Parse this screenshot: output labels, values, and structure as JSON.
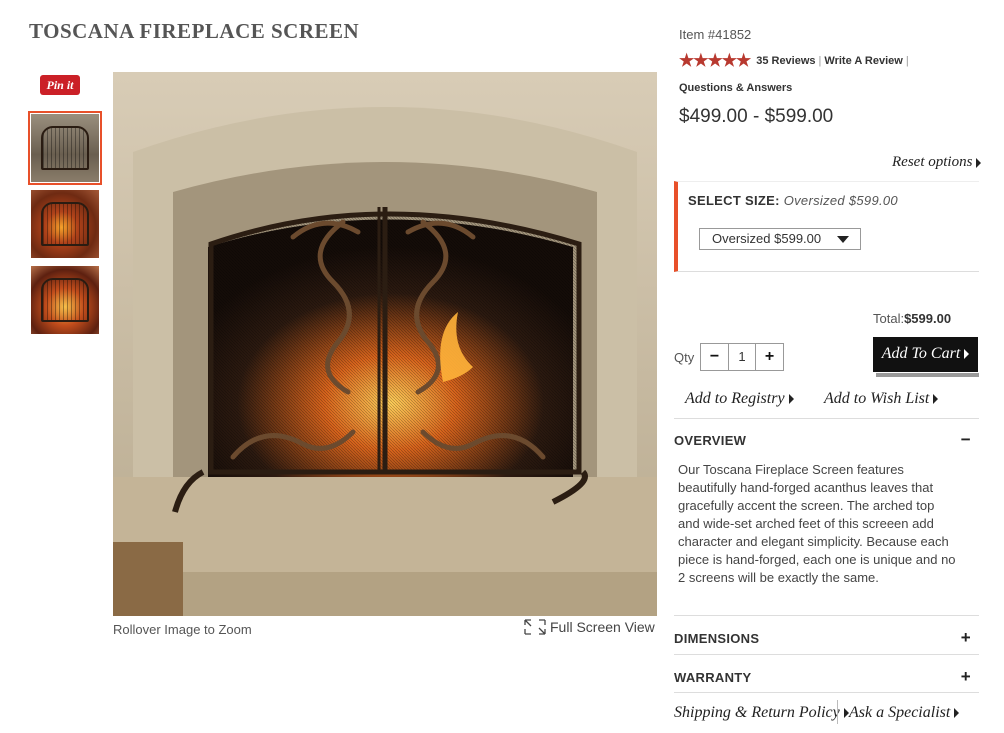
{
  "product": {
    "title": "TOSCANA FIREPLACE SCREEN",
    "item_number": "Item #41852",
    "rating_stars": 5,
    "stars_text": "★★★★★",
    "reviews_link": "35 Reviews",
    "write_review_link": "Write A Review",
    "qa_link": "Questions & Answers",
    "price_range": "$499.00 - $599.00"
  },
  "gallery": {
    "pin_label": "Pin it",
    "rollover_hint": "Rollover Image to Zoom",
    "full_screen_label": "Full Screen View",
    "thumbnails": [
      "thumbnail-1",
      "thumbnail-2",
      "thumbnail-3"
    ],
    "selected_thumbnail": 1
  },
  "options": {
    "reset_label": "Reset options",
    "size_label": "SELECT SIZE:",
    "size_selected": "Oversized $599.00",
    "size_dropdown_value": "Oversized $599.00"
  },
  "purchase": {
    "total_label": "Total:",
    "total_value": "$599.00",
    "qty_label": "Qty",
    "qty_minus": "−",
    "qty_value": "1",
    "qty_plus": "+",
    "add_to_cart": "Add To Cart",
    "add_to_registry": "Add to Registry",
    "add_to_wishlist": "Add to Wish List"
  },
  "accordion": {
    "overview_title": "OVERVIEW",
    "overview_sign": "−",
    "overview_text": "Our Toscana Fireplace Screen features beautifully hand-forged acanthus leaves that gracefully accent the screen. The arched top and wide-set arched feet of this screeen add character and elegant simplicity. Because each piece is hand-forged, each one is unique and no 2 screens will be exactly the same.",
    "dimensions_title": "DIMENSIONS",
    "dimensions_sign": "+",
    "warranty_title": "WARRANTY",
    "warranty_sign": "+"
  },
  "footer_links": {
    "shipping": "Shipping & Return Policy",
    "specialist": "Ask a Specialist"
  },
  "colors": {
    "accent": "#e8502a",
    "stars": "#b8392f",
    "pinterest": "#cb2027",
    "cart_button": "#111111"
  },
  "icons": {
    "pin": "pinterest-icon",
    "expand": "expand-icon",
    "caret": "chevron-down-icon",
    "arrow": "triangle-right-icon",
    "minus": "minus-icon",
    "plus": "plus-icon"
  }
}
